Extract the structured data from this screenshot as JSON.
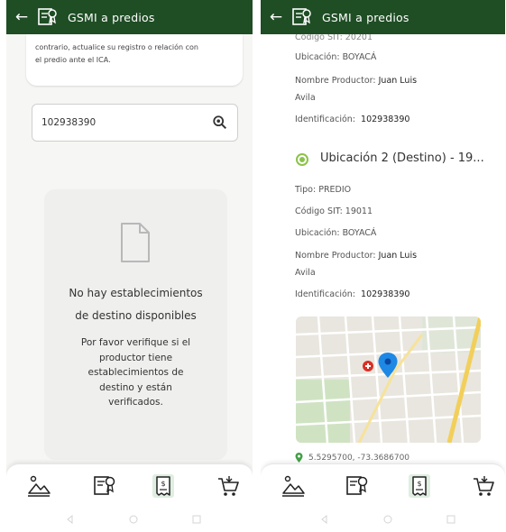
{
  "app": {
    "title": "GSMI a predios",
    "brand_color": "#1f4d24",
    "accent_color": "#8bc34a"
  },
  "left_screen": {
    "notice_lines": [
      "contrario, actualice su registro o relación con",
      "el predio ante el ICA."
    ],
    "search": {
      "value": "102938390",
      "icon": "search-icon"
    },
    "empty_state": {
      "icon": "document-icon",
      "heading_line1": "No hay establecimientos",
      "heading_line2": "de destino disponibles",
      "message_lines": [
        "Por favor verifique si el",
        "productor tiene",
        "establecimientos de",
        "destino y están",
        "verificados."
      ]
    }
  },
  "right_screen": {
    "partial_top": "Código SIT: 20201",
    "location1": {
      "ubicacion": "Ubicación: BOYACÁ",
      "productor_label": "Nombre Productor:",
      "productor_name": "Juan Luis",
      "productor_name2": "Avila",
      "identificacion_label": "Identificación:",
      "identificacion_value": "102938390"
    },
    "location2": {
      "title": "Ubicación 2 (Destino) - 19...",
      "tipo": "Tipo: PREDIO",
      "codigo": "Código SIT: 19011",
      "ubicacion": "Ubicación: BOYACÁ",
      "productor_label": "Nombre Productor:",
      "productor_name": "Juan Luis",
      "productor_name2": "Avila",
      "identificacion_label": "Identificación:",
      "identificacion_value": "102938390"
    },
    "coordinates": "5.5295700, -73.3686700"
  },
  "bottom_nav": [
    "landscape-icon",
    "certificate-icon",
    "receipt-icon",
    "cart-icon"
  ]
}
